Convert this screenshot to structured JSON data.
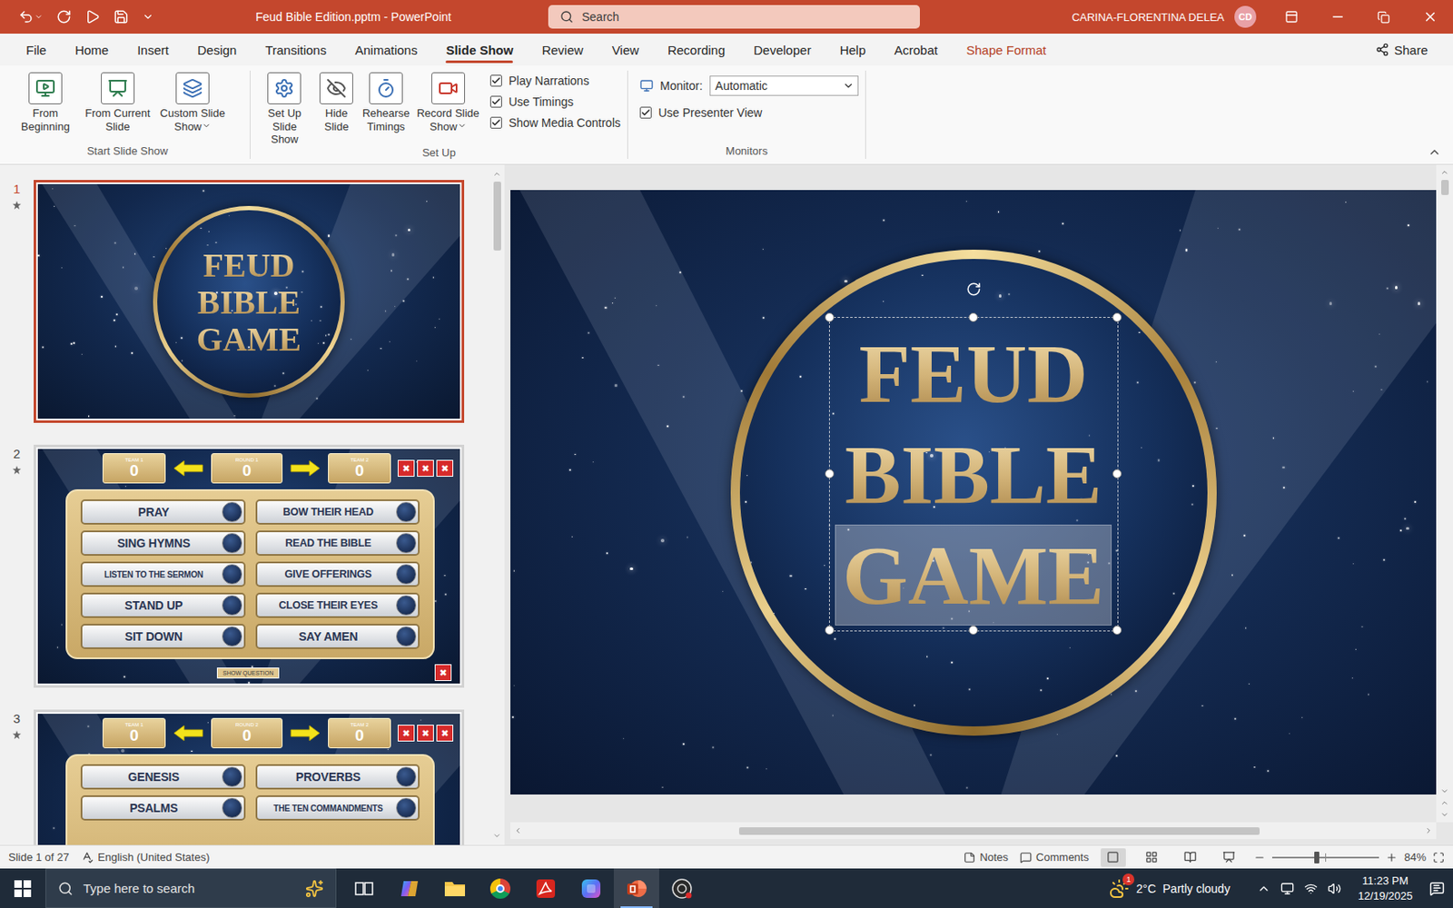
{
  "window": {
    "title": "Feud Bible Edition.pptm  -  PowerPoint",
    "search_placeholder": "Search",
    "user": "CARINA-FLORENTINA DELEA",
    "avatar": "CD"
  },
  "ribbon_tabs": [
    {
      "label": "File",
      "selected": false,
      "kind": "normal"
    },
    {
      "label": "Home",
      "selected": false,
      "kind": "normal"
    },
    {
      "label": "Insert",
      "selected": false,
      "kind": "normal"
    },
    {
      "label": "Design",
      "selected": false,
      "kind": "normal"
    },
    {
      "label": "Transitions",
      "selected": false,
      "kind": "normal"
    },
    {
      "label": "Animations",
      "selected": false,
      "kind": "normal"
    },
    {
      "label": "Slide Show",
      "selected": true,
      "kind": "normal"
    },
    {
      "label": "Review",
      "selected": false,
      "kind": "normal"
    },
    {
      "label": "View",
      "selected": false,
      "kind": "normal"
    },
    {
      "label": "Recording",
      "selected": false,
      "kind": "normal"
    },
    {
      "label": "Developer",
      "selected": false,
      "kind": "normal"
    },
    {
      "label": "Help",
      "selected": false,
      "kind": "normal"
    },
    {
      "label": "Acrobat",
      "selected": false,
      "kind": "normal"
    },
    {
      "label": "Shape Format",
      "selected": false,
      "kind": "contextual"
    }
  ],
  "share": "Share",
  "ribbon_groups": [
    {
      "label": "Start Slide Show",
      "kind": "buttons",
      "buttons": [
        {
          "label": "From Beginning",
          "menu": false
        },
        {
          "label": "From Current Slide",
          "menu": false
        },
        {
          "label": "Custom Slide Show",
          "menu": true
        }
      ],
      "checkboxes": []
    },
    {
      "label": "Set Up",
      "kind": "buttons",
      "buttons": [
        {
          "label": "Set Up Slide Show",
          "menu": false
        },
        {
          "label": "Hide Slide",
          "menu": false
        },
        {
          "label": "Rehearse Timings",
          "menu": false
        },
        {
          "label": "Record Slide Show",
          "menu": true
        }
      ],
      "checkboxes": [
        {
          "label": "Play Narrations",
          "checked": true
        },
        {
          "label": "Use Timings",
          "checked": true
        },
        {
          "label": "Show Media Controls",
          "checked": true
        }
      ]
    },
    {
      "label": "Monitors",
      "kind": "monitors",
      "buttons": [],
      "monitor": {
        "label": "Monitor:",
        "value": "Automatic"
      },
      "checkboxes": [
        {
          "label": "Use Presenter View",
          "checked": true
        }
      ]
    }
  ],
  "slides": [
    {
      "number": "1",
      "selected": true,
      "animated": true,
      "kind": "title",
      "lines": [
        "FEUD",
        "BIBLE",
        "GAME"
      ]
    },
    {
      "number": "2",
      "selected": false,
      "animated": true,
      "kind": "board",
      "team1": {
        "label": "TEAM 1",
        "score": "0"
      },
      "round": {
        "label": "ROUND 1",
        "score": "0"
      },
      "team2": {
        "label": "TEAM 2",
        "score": "0"
      },
      "strike": "✖",
      "answers": [
        "PRAY",
        "BOW THEIR HEAD",
        "SING HYMNS",
        "READ THE BIBLE",
        "LISTEN TO THE SERMON",
        "GIVE OFFERINGS",
        "STAND UP",
        "CLOSE THEIR EYES",
        "SIT DOWN",
        "SAY AMEN"
      ],
      "button": "SHOW QUESTION"
    },
    {
      "number": "3",
      "selected": false,
      "animated": true,
      "kind": "board",
      "team1": {
        "label": "TEAM 1",
        "score": "0"
      },
      "round": {
        "label": "ROUND 2",
        "score": "0"
      },
      "team2": {
        "label": "TEAM 2",
        "score": "0"
      },
      "strike": "✖",
      "answers": [
        "GENESIS",
        "PROVERBS",
        "PSALMS",
        "THE TEN COMMANDMENTS"
      ]
    }
  ],
  "canvas": {
    "textbox_selected": true,
    "lines": [
      {
        "text": "FEUD",
        "selected": false
      },
      {
        "text": "BIBLE",
        "selected": false
      },
      {
        "text": "GAME",
        "selected": true
      }
    ]
  },
  "status_bar": {
    "slide": "Slide 1 of 27",
    "language": "English (United States)",
    "notes": "Notes",
    "comments": "Comments",
    "zoom": "84%",
    "zoom_level": 0.42,
    "views": [
      {
        "kind": "normal",
        "selected": true
      },
      {
        "kind": "sorter",
        "selected": false
      },
      {
        "kind": "reading",
        "selected": false
      },
      {
        "kind": "slideshow",
        "selected": false
      }
    ]
  },
  "taskbar": {
    "search_placeholder": "Type here to search",
    "apps": [
      {
        "kind": "taskview",
        "active": false
      },
      {
        "kind": "copilot",
        "active": false
      },
      {
        "kind": "explorer",
        "active": false
      },
      {
        "kind": "chrome",
        "active": false
      },
      {
        "kind": "acrobat",
        "active": false
      },
      {
        "kind": "m365",
        "active": false
      },
      {
        "kind": "powerpoint",
        "active": true
      },
      {
        "kind": "recorder",
        "active": false
      }
    ],
    "weather": {
      "badge": "1",
      "temp": "2°C",
      "condition": "Partly cloudy"
    },
    "time": "11:23 PM",
    "date": "12/19/2025"
  }
}
